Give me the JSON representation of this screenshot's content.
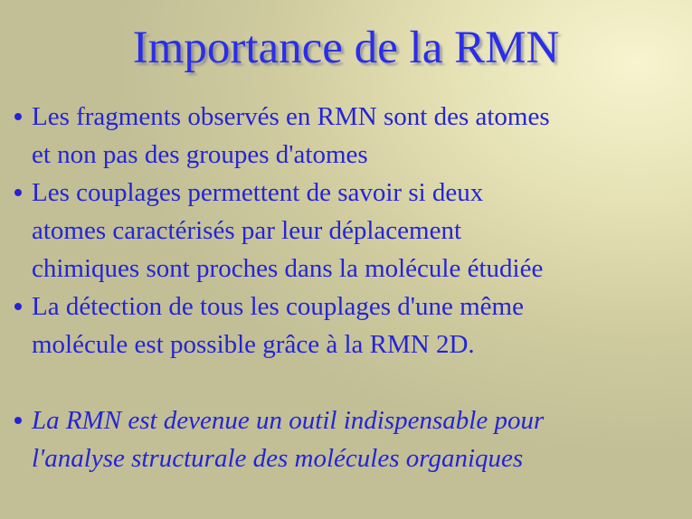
{
  "title": "Importance de la RMN",
  "bullets": [
    {
      "lines": [
        "Les fragments observés en RMN sont des atomes",
        "et non pas des groupes d'atomes"
      ]
    },
    {
      "lines": [
        "Les couplages permettent de savoir si deux",
        "atomes caractérisés par leur déplacement",
        "chimiques sont proches dans la molécule étudiée"
      ]
    },
    {
      "lines": [
        "La détection de tous les couplages d'une même",
        "molécule est possible grâce à la RMN 2D."
      ]
    },
    {
      "lines": [
        "La RMN est devenue un outil indispensable pour",
        "l'analyse structurale des molécules organiques"
      ]
    }
  ],
  "colors": {
    "text": "#2424d6",
    "title": "#2a2ee8"
  }
}
